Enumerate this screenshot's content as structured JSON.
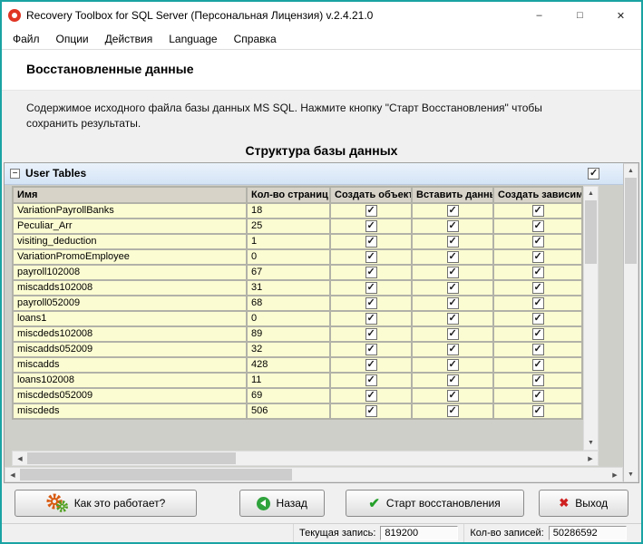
{
  "window": {
    "title": "Recovery Toolbox for SQL Server (Персональная Лицензия) v.2.4.21.0"
  },
  "menu": {
    "items": [
      "Файл",
      "Опции",
      "Действия",
      "Language",
      "Справка"
    ]
  },
  "page": {
    "heading": "Восстановленные данные",
    "description": "Содержимое исходного файла базы данных MS SQL. Нажмите кнопку \"Старт Восстановления\" чтобы сохранить результаты.",
    "section_title": "Структура базы данных"
  },
  "panel": {
    "title": "User Tables",
    "checkbox_checked": true
  },
  "table": {
    "columns": [
      "Имя",
      "Кол-во страниц",
      "Создать объект",
      "Вставить даннь",
      "Создать зависимые"
    ],
    "rows": [
      {
        "name": "VariationPayrollBanks",
        "pages": "18",
        "create_object": true,
        "insert_data": true,
        "create_dependent": true
      },
      {
        "name": "Peculiar_Arr",
        "pages": "25",
        "create_object": true,
        "insert_data": true,
        "create_dependent": true
      },
      {
        "name": "visiting_deduction",
        "pages": "1",
        "create_object": true,
        "insert_data": true,
        "create_dependent": true
      },
      {
        "name": "VariationPromoEmployee",
        "pages": "0",
        "create_object": true,
        "insert_data": true,
        "create_dependent": true
      },
      {
        "name": "payroll102008",
        "pages": "67",
        "create_object": true,
        "insert_data": true,
        "create_dependent": true
      },
      {
        "name": "miscadds102008",
        "pages": "31",
        "create_object": true,
        "insert_data": true,
        "create_dependent": true
      },
      {
        "name": "payroll052009",
        "pages": "68",
        "create_object": true,
        "insert_data": true,
        "create_dependent": true
      },
      {
        "name": "loans1",
        "pages": "0",
        "create_object": true,
        "insert_data": true,
        "create_dependent": true
      },
      {
        "name": "miscdeds102008",
        "pages": "89",
        "create_object": true,
        "insert_data": true,
        "create_dependent": true
      },
      {
        "name": "miscadds052009",
        "pages": "32",
        "create_object": true,
        "insert_data": true,
        "create_dependent": true
      },
      {
        "name": "miscadds",
        "pages": "428",
        "create_object": true,
        "insert_data": true,
        "create_dependent": true
      },
      {
        "name": "loans102008",
        "pages": "11",
        "create_object": true,
        "insert_data": true,
        "create_dependent": true
      },
      {
        "name": "miscdeds052009",
        "pages": "69",
        "create_object": true,
        "insert_data": true,
        "create_dependent": true
      },
      {
        "name": "miscdeds",
        "pages": "506",
        "create_object": true,
        "insert_data": true,
        "create_dependent": true
      }
    ]
  },
  "buttons": {
    "how_it_works": "Как это работает?",
    "back": "Назад",
    "start": "Старт восстановления",
    "exit": "Выход"
  },
  "statusbar": {
    "current_record_label": "Текущая запись:",
    "current_record_value": "819200",
    "total_records_label": "Кол-во записей:",
    "total_records_value": "50286592"
  },
  "glyphs": {
    "collapse": "−",
    "up": "▲",
    "down": "▼",
    "left": "◀",
    "right": "▶",
    "minimize": "–",
    "maximize": "□",
    "close": "✕",
    "check": "✔",
    "cross": "✖"
  },
  "colors": {
    "window_border": "#1aa3a3",
    "row_background": "#fcfcd2",
    "panel_header_blue": "#d4e4f6"
  }
}
